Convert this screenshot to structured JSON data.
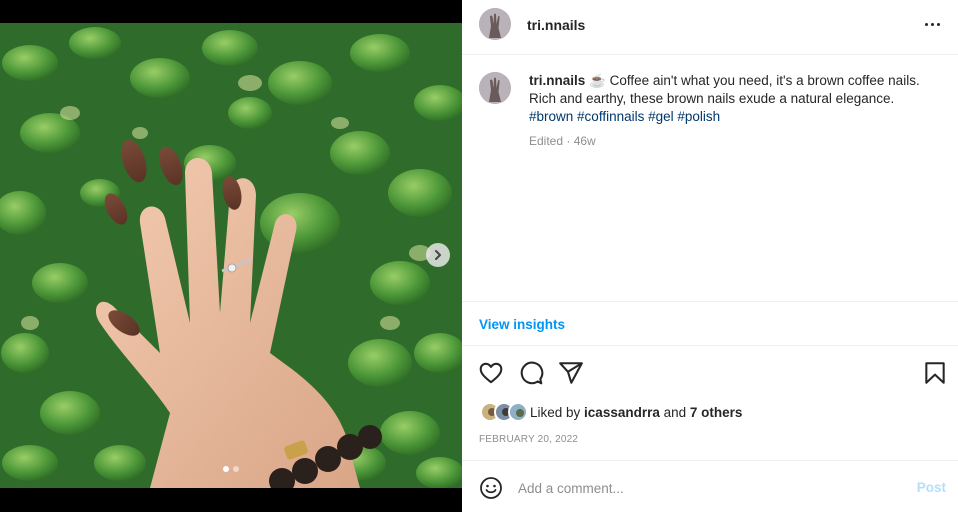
{
  "post": {
    "username": "tri.nnails",
    "caption_emoji": "☕",
    "caption_text": " Coffee ain't what you need, it's a brown coffee nails. Rich and earthy, these brown nails exude a natural elegance.",
    "hashtags": [
      "#brown",
      "#coffinnails",
      "#gel",
      "#polish"
    ],
    "edited_label": "Edited · 46w",
    "view_insights": "View insights",
    "liked_by_prefix": "Liked by ",
    "liked_by_user": "icassandrra",
    "liked_by_and": " and ",
    "liked_by_others": "7 others",
    "date": "FEBRUARY 20, 2022",
    "comment_placeholder": "Add a comment...",
    "post_button": "Post",
    "carousel_current": 1,
    "carousel_total": 2
  },
  "colors": {
    "link_blue": "#0095f6",
    "hashtag_blue": "#00376b",
    "muted": "#8e8e8e",
    "text": "#262626",
    "post_disabled": "#b2dffc",
    "nail_brown": "#6b3f2e"
  },
  "icons": {
    "more": "more-horizontal-icon",
    "next": "chevron-right-icon",
    "like": "heart-icon",
    "comment": "comment-bubble-icon",
    "share": "paper-plane-icon",
    "save": "bookmark-icon",
    "emoji": "smiley-icon"
  }
}
